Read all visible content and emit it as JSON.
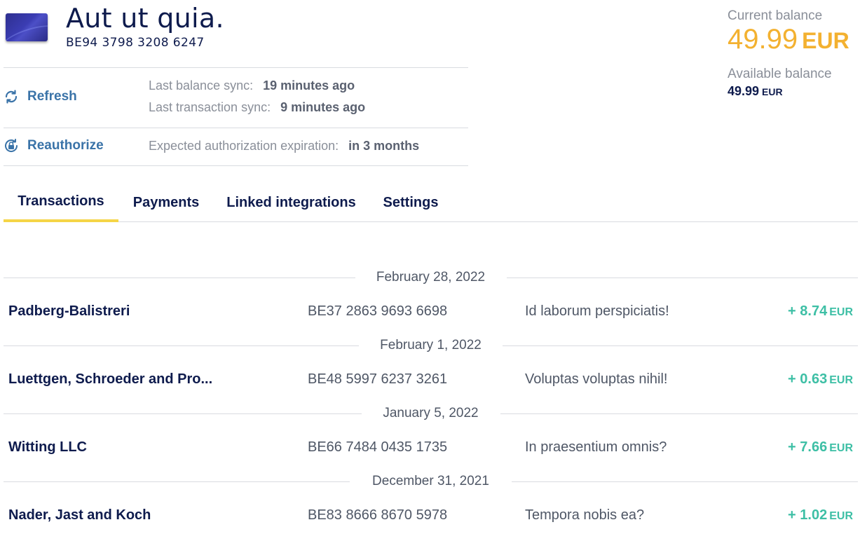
{
  "account": {
    "name": "Aut ut quia.",
    "iban": "BE94 3798 3208 6247",
    "card_icon": "bank-card-icon"
  },
  "actions": {
    "refresh_label": "Refresh",
    "reauthorize_label": "Reauthorize"
  },
  "sync": {
    "balance_label": "Last balance sync:",
    "balance_value": "19 minutes ago",
    "transaction_label": "Last transaction sync:",
    "transaction_value": "9 minutes ago",
    "expiration_label": "Expected authorization expiration:",
    "expiration_value": "in 3 months"
  },
  "balance": {
    "current_label": "Current balance",
    "current_value": "49.99",
    "current_currency": "EUR",
    "available_label": "Available balance",
    "available_value": "49.99",
    "available_currency": "EUR",
    "accent_color": "#f3b130"
  },
  "tabs": [
    {
      "label": "Transactions",
      "active": true
    },
    {
      "label": "Payments",
      "active": false
    },
    {
      "label": "Linked integrations",
      "active": false
    },
    {
      "label": "Settings",
      "active": false
    }
  ],
  "transactions": [
    {
      "date": "February 28, 2022",
      "name": "Padberg-Balistreri",
      "iban": "BE37 2863 9693 6698",
      "description": "Id laborum perspiciatis!",
      "amount": "+ 8.74",
      "currency": "EUR"
    },
    {
      "date": "February 1, 2022",
      "name": "Luettgen, Schroeder and Pro...",
      "iban": "BE48 5997 6237 3261",
      "description": "Voluptas voluptas nihil!",
      "amount": "+ 0.63",
      "currency": "EUR"
    },
    {
      "date": "January 5, 2022",
      "name": "Witting LLC",
      "iban": "BE66 7484 0435 1735",
      "description": "In praesentium omnis?",
      "amount": "+ 7.66",
      "currency": "EUR"
    },
    {
      "date": "December 31, 2021",
      "name": "Nader, Jast and Koch",
      "iban": "BE83 8666 8670 5978",
      "description": "Tempora nobis ea?",
      "amount": "+ 1.02",
      "currency": "EUR"
    }
  ],
  "colors": {
    "positive_amount": "#3dbfa5",
    "link": "#3a73a8",
    "tab_indicator": "#f5d547"
  }
}
